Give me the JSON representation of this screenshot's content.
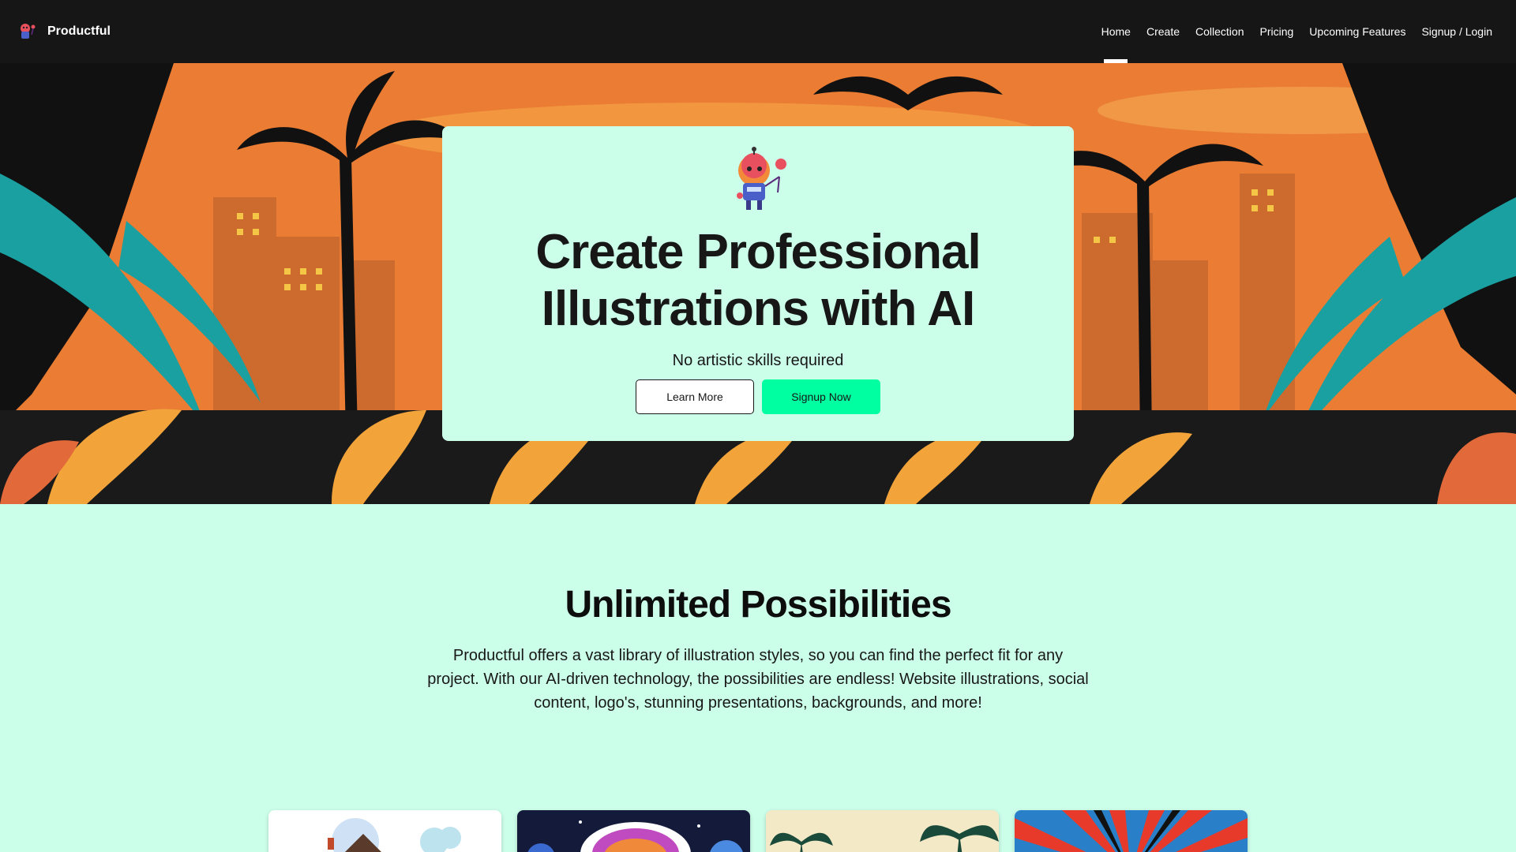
{
  "nav": {
    "brand": "Productful",
    "links": [
      {
        "label": "Home",
        "active": true
      },
      {
        "label": "Create"
      },
      {
        "label": "Collection"
      },
      {
        "label": "Pricing"
      },
      {
        "label": "Upcoming Features"
      },
      {
        "label": "Signup / Login"
      }
    ]
  },
  "hero": {
    "title": "Create Professional Illustrations with AI",
    "subtitle": "No artistic skills required",
    "buttons": {
      "learn_more": "Learn More",
      "signup": "Signup Now"
    }
  },
  "possibilities": {
    "title": "Unlimited Possibilities",
    "text": "Productful offers a vast library of illustration styles, so you can find the perfect fit for any project. With our AI-driven technology, the possibilities are endless! Website illustrations, social content, logo's, stunning presentations, backgrounds, and more!"
  },
  "colors": {
    "nav_bg": "#161616",
    "accent": "#00ffa0",
    "mint": "#ccffea"
  }
}
